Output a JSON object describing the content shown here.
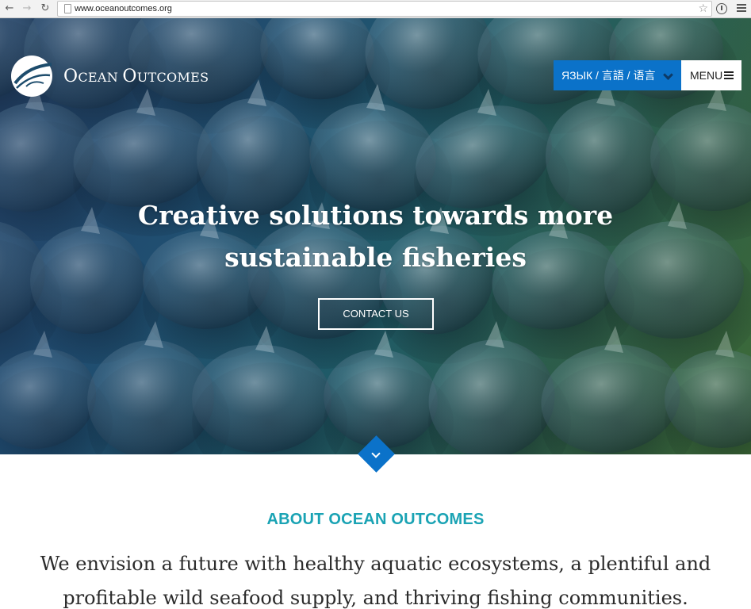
{
  "browser": {
    "url": "www.oceanoutcomes.org",
    "back_icon": "back-arrow-icon",
    "forward_icon": "forward-arrow-icon",
    "reload_icon": "reload-icon"
  },
  "header": {
    "logo_text_first": "O",
    "logo_text_rest1": "CEAN ",
    "logo_text_second": "O",
    "logo_text_rest2": "UTCOMES",
    "language_label": "ЯЗЫК / 言語 / 语言",
    "menu_label": "MENU"
  },
  "hero": {
    "headline": "Creative solutions towards more sustainable fisheries",
    "cta_label": "CONTACT US"
  },
  "about": {
    "title": "ABOUT OCEAN OUTCOMES",
    "text": "We envision a future with healthy aquatic ecosystems, a plentiful and profitable wild seafood supply, and thriving fishing communities."
  },
  "colors": {
    "accent_blue": "#0b72c9",
    "about_title": "#1aa3b4",
    "hero_dark": "#205171",
    "hero_green": "#3a6a3c"
  }
}
